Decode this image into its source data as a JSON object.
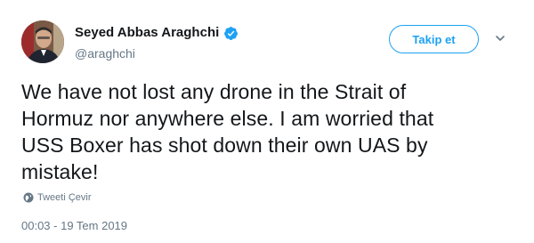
{
  "author": {
    "display_name": "Seyed Abbas Araghchi",
    "handle": "@araghchi",
    "verified": true,
    "avatar_icon": "profile-photo"
  },
  "actions": {
    "follow_label": "Takip et",
    "menu_icon": "chevron-down-icon"
  },
  "tweet": {
    "text": "We have not lost any drone in the Strait of\nHormuz nor anywhere else. I am worried that\nUSS Boxer has shot down their own UAS by\nmistake!",
    "translate_label": "Tweeti Çevir",
    "translate_icon": "globe-icon",
    "timestamp": "00:03 - 19 Tem 2019"
  },
  "colors": {
    "accent": "#1da1f2",
    "text": "#14171a",
    "muted": "#657786"
  }
}
